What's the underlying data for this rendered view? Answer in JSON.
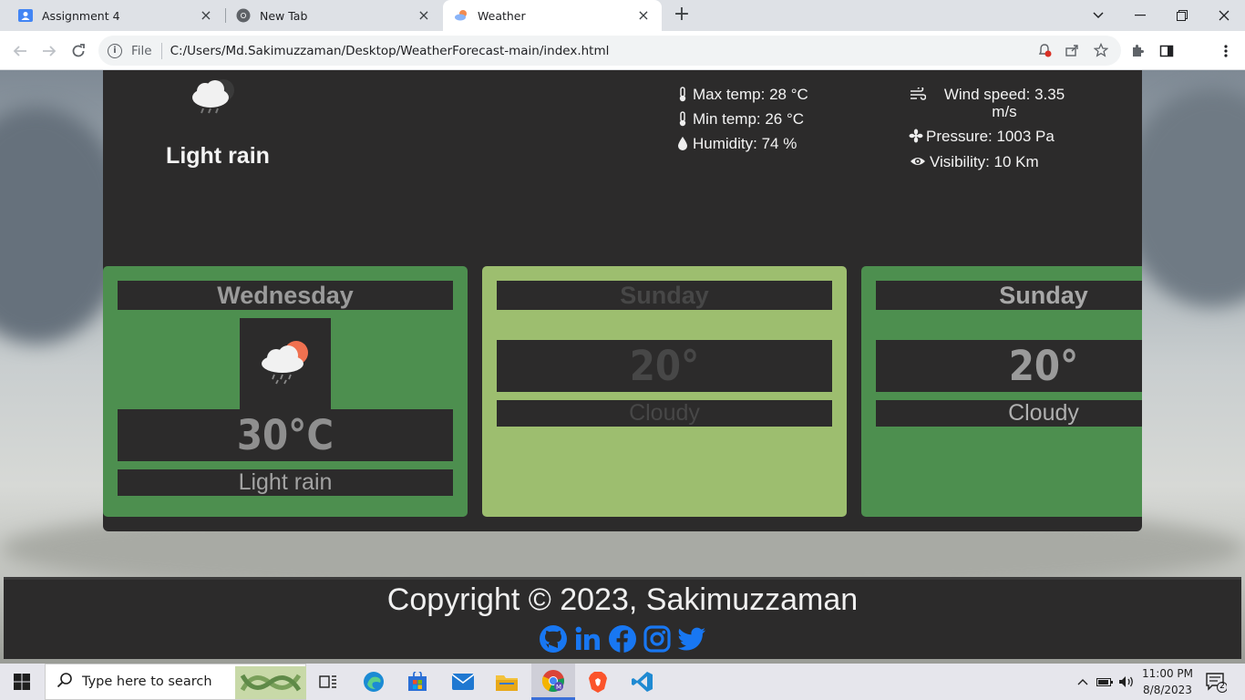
{
  "browser": {
    "tabs": [
      {
        "title": "Assignment 4",
        "active": false
      },
      {
        "title": "New Tab",
        "active": false
      },
      {
        "title": "Weather",
        "active": true
      }
    ],
    "url_scheme": "File",
    "url": "C:/Users/Md.Sakimuzzaman/Desktop/WeatherForecast-main/index.html",
    "profile_initial": "M"
  },
  "current": {
    "condition": "Light rain",
    "max_temp": "Max temp: 28 °C",
    "min_temp": "Min temp: 26 °C",
    "humidity": "Humidity: 74 %",
    "wind_speed": "Wind speed: 3.35 m/s",
    "pressure": "Pressure: 1003 Pa",
    "visibility": "Visibility: 10 Km"
  },
  "forecast": [
    {
      "day": "Wednesday",
      "temp": "30°C",
      "desc": "Light rain",
      "bg": "#4d8f4f"
    },
    {
      "day": "Sunday",
      "temp": "20°",
      "desc": "Cloudy",
      "bg": "#9dbe6f"
    },
    {
      "day": "Sunday",
      "temp": "20°",
      "desc": "Cloudy",
      "bg": "#4d8f4f"
    }
  ],
  "footer": {
    "copyright": "Copyright © 2023, Sakimuzzaman",
    "socials": [
      "github-icon",
      "linkedin-icon",
      "facebook-icon",
      "instagram-icon",
      "twitter-icon"
    ],
    "social_color": "#1877f2"
  },
  "taskbar": {
    "search_placeholder": "Type here to search",
    "time": "11:00 PM",
    "date": "8/8/2023",
    "notification_count": "2"
  }
}
